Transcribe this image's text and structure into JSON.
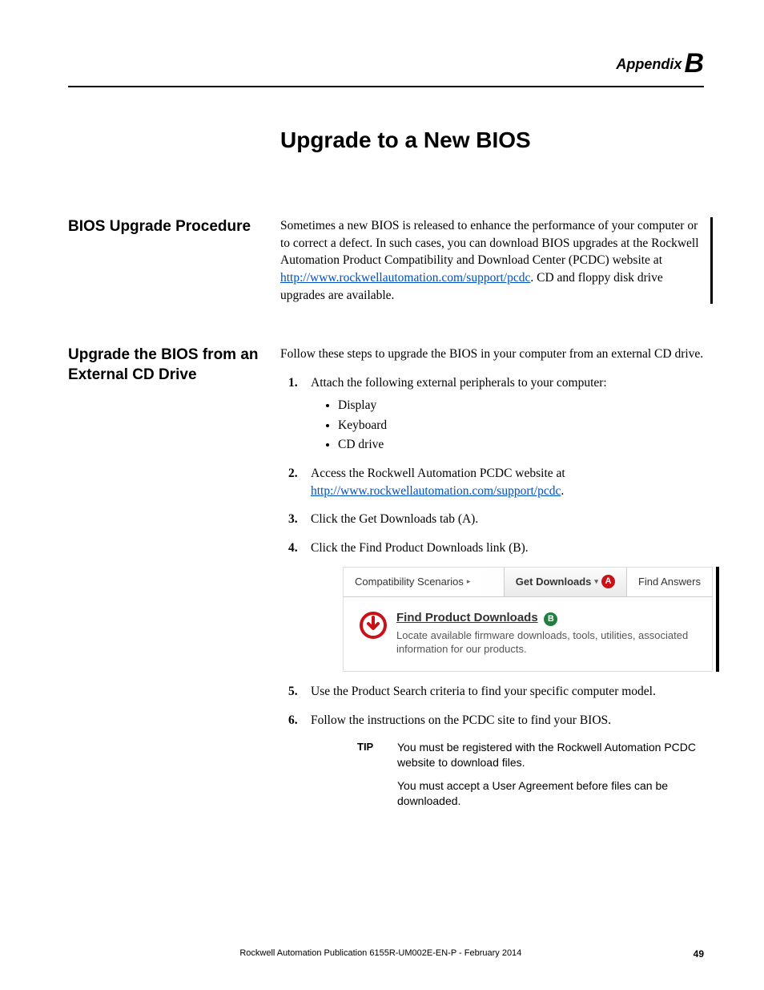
{
  "header": {
    "appendix_word": "Appendix",
    "appendix_letter": "B"
  },
  "title": "Upgrade to a New BIOS",
  "section1": {
    "heading": "BIOS Upgrade Procedure",
    "p1a": "Sometimes a new BIOS is released to enhance the performance of your computer or to correct a defect. In such cases, you can download BIOS upgrades at the Rockwell Automation Product Compatibility and Download Center (PCDC) website at",
    "link": " http://www.rockwellautomation.com/support/pcdc",
    "p1b": ". CD and floppy disk drive upgrades are available."
  },
  "section2": {
    "heading": "Upgrade the BIOS from an External CD Drive",
    "intro": "Follow these steps to upgrade the BIOS in your computer from an external CD drive.",
    "step1": "Attach the following external peripherals to your computer:",
    "bullets": [
      "Display",
      "Keyboard",
      "CD drive"
    ],
    "step2a": "Access the Rockwell Automation PCDC website at ",
    "step2link": "http://www.rockwellautomation.com/support/pcdc",
    "step2b": ".",
    "step3": "Click the Get Downloads tab (A).",
    "step4": "Click the Find Product Downloads link (B).",
    "step5": "Use the Product Search criteria to find your specific computer model.",
    "step6": "Follow the instructions on the PCDC site to find your BIOS."
  },
  "screenshot": {
    "tab1": "Compatibility Scenarios",
    "tab2": "Get Downloads",
    "tab3": "Find Answers",
    "markerA": "A",
    "markerB": "B",
    "link_label": "Find Product Downloads",
    "subtext": "Locate available firmware downloads, tools, utilities, associated information for our products."
  },
  "tip": {
    "label": "TIP",
    "p1": "You must be registered with the Rockwell Automation PCDC website to download files.",
    "p2": "You must accept a User Agreement before files can be downloaded."
  },
  "footer": {
    "publication": "Rockwell Automation Publication 6155R-UM002E-EN-P - February 2014",
    "page": "49"
  }
}
